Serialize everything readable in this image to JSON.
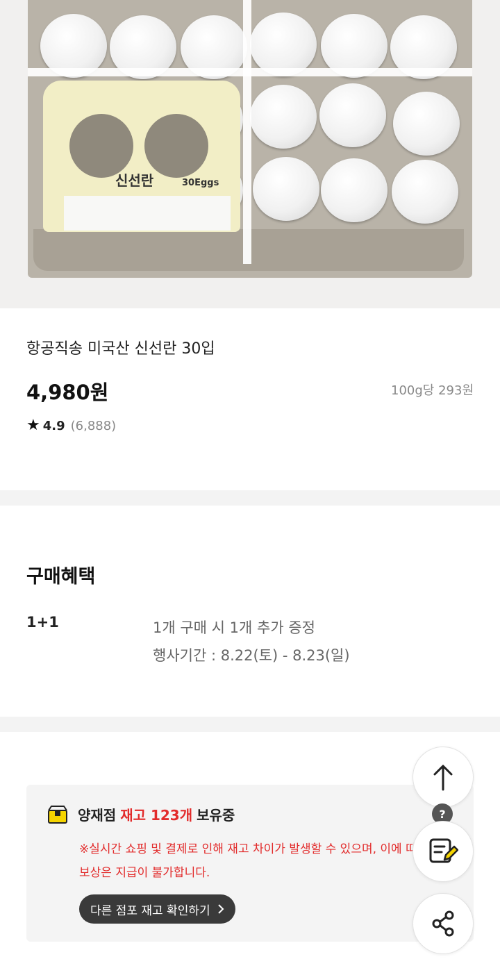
{
  "product_image": {
    "label_main": "신선란",
    "label_sub": "30Eggs"
  },
  "product": {
    "name": "항공직송 미국산 신선란 30입",
    "price": "4,980원",
    "unit_price": "100g당 293원",
    "rating": {
      "icon": "star-icon",
      "score": "4.9",
      "count": "(6,888)"
    }
  },
  "benefits": {
    "title": "구매혜택",
    "items": [
      {
        "key": "1+1",
        "desc_line1": "1개 구매 시 1개 추가 증정",
        "desc_line2": "행사기간 : 8.22(토) - 8.23(일)"
      }
    ]
  },
  "stock": {
    "icon": "store-icon",
    "store": "양재점",
    "highlight": "재고 123개",
    "suffix": "보유중",
    "notice": "※실시간 쇼핑 및 결제로 인해 재고 차이가 발생할 수 있으며, 이에 따른 보상은 지급이 불가합니다.",
    "button_label": "다른 점포 재고 확인하기",
    "button_icon": "chevron-right-icon"
  },
  "floating": {
    "help_badge": "?",
    "buttons": [
      "scroll-top-icon",
      "memo-edit-icon",
      "share-icon"
    ]
  },
  "colors": {
    "accent_red": "#e22b2b",
    "button_dark": "#3a3a3a",
    "icon_yellow": "#f5d400"
  }
}
